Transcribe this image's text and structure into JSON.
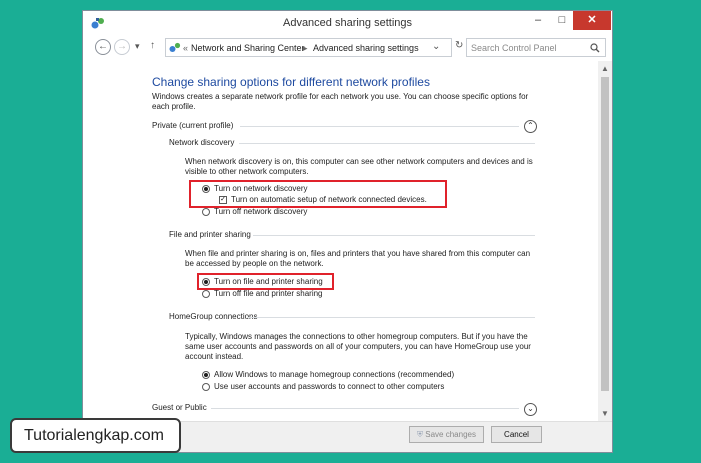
{
  "window": {
    "title": "Advanced sharing settings",
    "minimize_glyph": "–",
    "maximize_glyph": "□",
    "close_glyph": "✕"
  },
  "address": {
    "back_glyph": "←",
    "forward_glyph": "→",
    "recent_glyph": "▾",
    "up_glyph": "↑",
    "overflow": "«",
    "crumb1": "Network and Sharing Center",
    "sep": "▸",
    "crumb2": "Advanced sharing settings",
    "dropdown_glyph": "⌄",
    "refresh_glyph": "↻",
    "search_placeholder": "Search Control Panel"
  },
  "page": {
    "heading": "Change sharing options for different network profiles",
    "intro": "Windows creates a separate network profile for each network you use. You can choose specific options for each profile.",
    "private_profile": "Private (current profile)",
    "collapse_glyph": "⌃",
    "expand_glyph": "⌄",
    "network_discovery": {
      "title": "Network discovery",
      "desc": "When network discovery is on, this computer can see other network computers and devices and is visible to other network computers.",
      "opt_on": "Turn on network discovery",
      "opt_auto": "Turn on automatic setup of network connected devices.",
      "opt_off": "Turn off network discovery"
    },
    "file_printer": {
      "title": "File and printer sharing",
      "desc": "When file and printer sharing is on, files and printers that you have shared from this computer can be accessed by people on the network.",
      "opt_on": "Turn on file and printer sharing",
      "opt_off": "Turn off file and printer sharing"
    },
    "homegroup": {
      "title": "HomeGroup connections",
      "desc": "Typically, Windows manages the connections to other homegroup computers. But if you have the same user accounts and passwords on all of your computers, you can have HomeGroup use your account instead.",
      "opt_allow": "Allow Windows to manage homegroup connections (recommended)",
      "opt_user": "Use user accounts and passwords to connect to other computers"
    },
    "guest_public": "Guest or Public"
  },
  "footer": {
    "save_label": "Save changes",
    "cancel_label": "Cancel"
  },
  "overlay": {
    "site_label": "Tutorialengkap.com"
  },
  "colors": {
    "background": "#1aae95",
    "heading": "#1e4aa0",
    "highlight": "#e0222b",
    "close_button": "#c7382d"
  }
}
